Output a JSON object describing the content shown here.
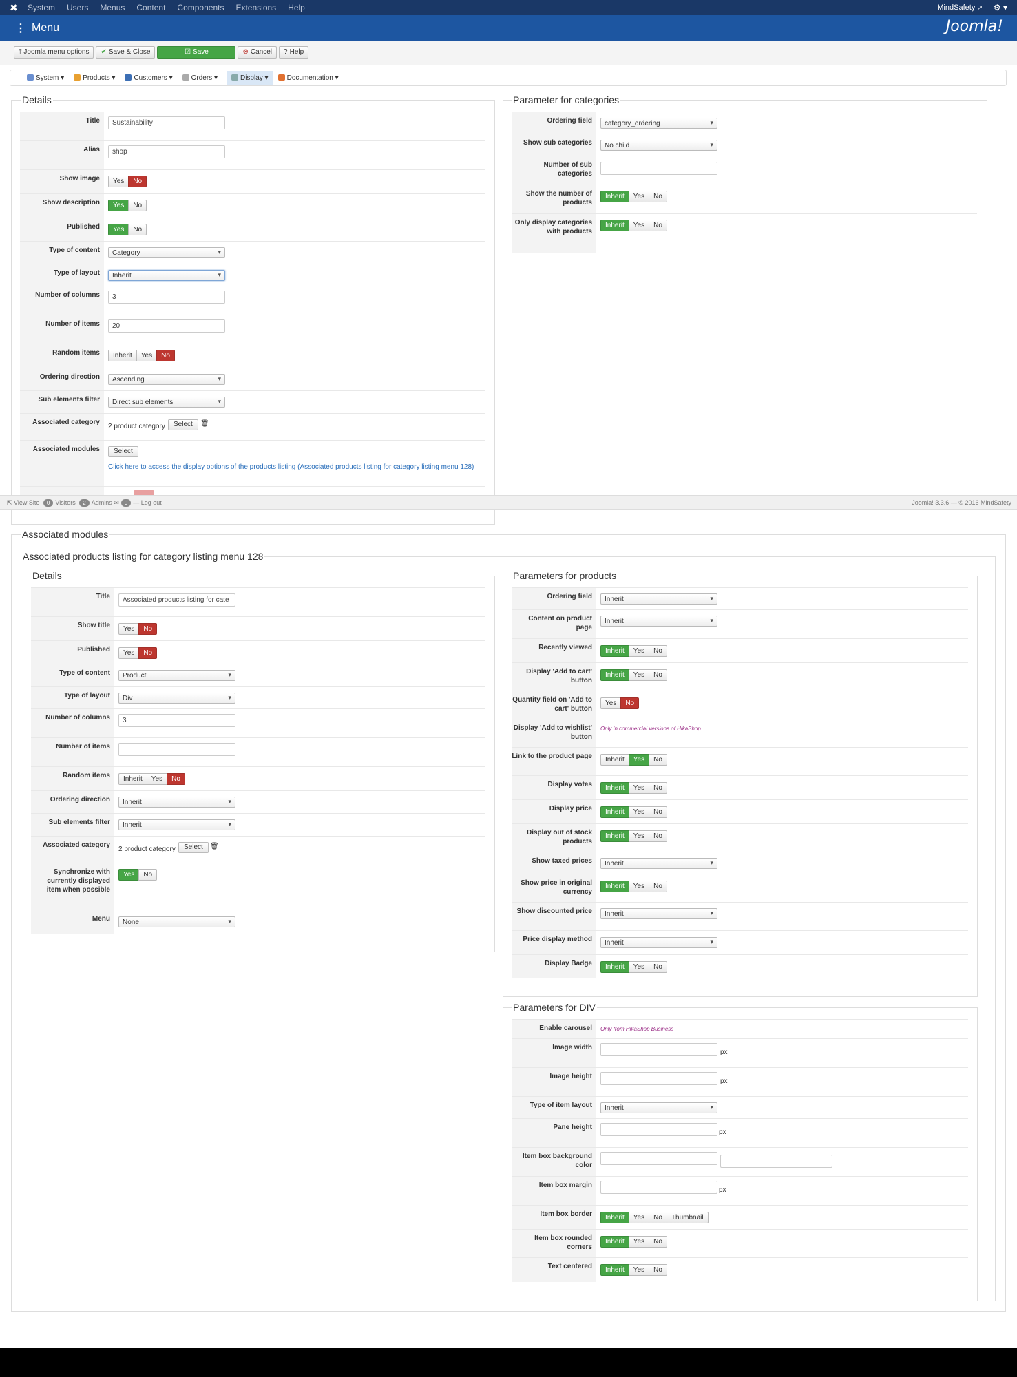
{
  "topnav": {
    "items": [
      "System",
      "Users",
      "Menus",
      "Content",
      "Components",
      "Extensions",
      "Help"
    ],
    "site_name": "MindSafety"
  },
  "title": "Menu",
  "brand": "Joomla!",
  "toolbar": {
    "options": "Joomla menu options",
    "save_close": "Save & Close",
    "save": "Save",
    "cancel": "Cancel",
    "help": "Help"
  },
  "submenu": [
    {
      "label": "System",
      "color": "#6a8fd0"
    },
    {
      "label": "Products",
      "color": "#e8a030"
    },
    {
      "label": "Customers",
      "color": "#3c6fb5"
    },
    {
      "label": "Orders",
      "color": "#aaa"
    },
    {
      "label": "Display",
      "color": "#8aa"
    },
    {
      "label": "Documentation",
      "color": "#e07030"
    }
  ],
  "details1": {
    "legend": "Details",
    "title_label": "Title",
    "title_value": "Sustainability",
    "alias_label": "Alias",
    "alias_value": "shop",
    "show_image_label": "Show image",
    "show_desc_label": "Show description",
    "published_label": "Published",
    "type_content_label": "Type of content",
    "type_content_value": "Category",
    "type_layout_label": "Type of layout",
    "type_layout_value": "Inherit",
    "num_cols_label": "Number of columns",
    "num_cols_value": "3",
    "num_items_label": "Number of items",
    "num_items_value": "20",
    "random_label": "Random items",
    "ordering_label": "Ordering direction",
    "ordering_value": "Ascending",
    "sub_label": "Sub elements filter",
    "sub_value": "Direct sub elements",
    "assoc_cat_label": "Associated category",
    "assoc_cat_value": "2 product category",
    "select": "Select",
    "assoc_mod_label": "Associated modules",
    "assoc_mod_link": "Click here to access the display options of the products listing (Associated products listing for category listing menu 128)"
  },
  "cats": {
    "legend": "Parameter for categories",
    "ordering_label": "Ordering field",
    "ordering_value": "category_ordering",
    "showsub_label": "Show sub categories",
    "showsub_value": "No child",
    "numsub_label": "Number of sub categories",
    "shownum_label": "Show the number of products",
    "onlydisp_label": "Only display categories with products"
  },
  "buttons": {
    "yes": "Yes",
    "no": "No",
    "inherit": "Inherit",
    "thumbnail": "Thumbnail"
  },
  "status": {
    "view_site": "View Site",
    "visitors_count": "0",
    "visitors": "Visitors",
    "admins_count": "2",
    "admins": "Admins",
    "msg_count": "0",
    "logout": "Log out",
    "version": "Joomla! 3.3.6 — © 2016 MindSafety"
  },
  "assoc": {
    "legend": "Associated modules",
    "inner_legend": "Associated products listing for category listing menu 128"
  },
  "details2": {
    "legend": "Details",
    "title_label": "Title",
    "title_value": "Associated products listing for cate",
    "show_title_label": "Show title",
    "published_label": "Published",
    "type_content_label": "Type of content",
    "type_content_value": "Product",
    "type_layout_label": "Type of layout",
    "type_layout_value": "Div",
    "num_cols_label": "Number of columns",
    "num_cols_value": "3",
    "num_items_label": "Number of items",
    "random_label": "Random items",
    "ordering_label": "Ordering direction",
    "ordering_value": "Inherit",
    "sub_label": "Sub elements filter",
    "sub_value": "Inherit",
    "assoc_cat_label": "Associated category",
    "assoc_cat_value": "2 product category",
    "select": "Select",
    "sync_label": "Synchronize with currently displayed item when possible",
    "menu_label": "Menu",
    "menu_value": "None"
  },
  "prod": {
    "legend": "Parameters for products",
    "ordering_label": "Ordering field",
    "ordering_value": "Inherit",
    "content_label": "Content on product page",
    "content_value": "Inherit",
    "recent_label": "Recently viewed",
    "addcart_label": "Display 'Add to cart' button",
    "qty_label": "Quantity field on 'Add to cart' button",
    "wishlist_label": "Display 'Add to wishlist' button",
    "wishlist_note": "Only in commercial versions of HikaShop",
    "link_label": "Link to the product page",
    "votes_label": "Display votes",
    "price_label": "Display price",
    "oos_label": "Display out of stock products",
    "taxed_label": "Show taxed prices",
    "taxed_value": "Inherit",
    "orig_label": "Show price in original currency",
    "disc_label": "Show discounted price",
    "disc_value": "Inherit",
    "method_label": "Price display method",
    "method_value": "Inherit",
    "badge_label": "Display Badge"
  },
  "div": {
    "legend": "Parameters for DIV",
    "carousel_label": "Enable carousel",
    "carousel_note": "Only from HikaShop Business",
    "imgw_label": "Image width",
    "imgh_label": "Image height",
    "itemlayout_label": "Type of item layout",
    "itemlayout_value": "Inherit",
    "pane_label": "Pane height",
    "bg_label": "Item box background color",
    "margin_label": "Item box margin",
    "border_label": "Item box border",
    "rounded_label": "Item box rounded corners",
    "centered_label": "Text centered",
    "px": "px"
  }
}
